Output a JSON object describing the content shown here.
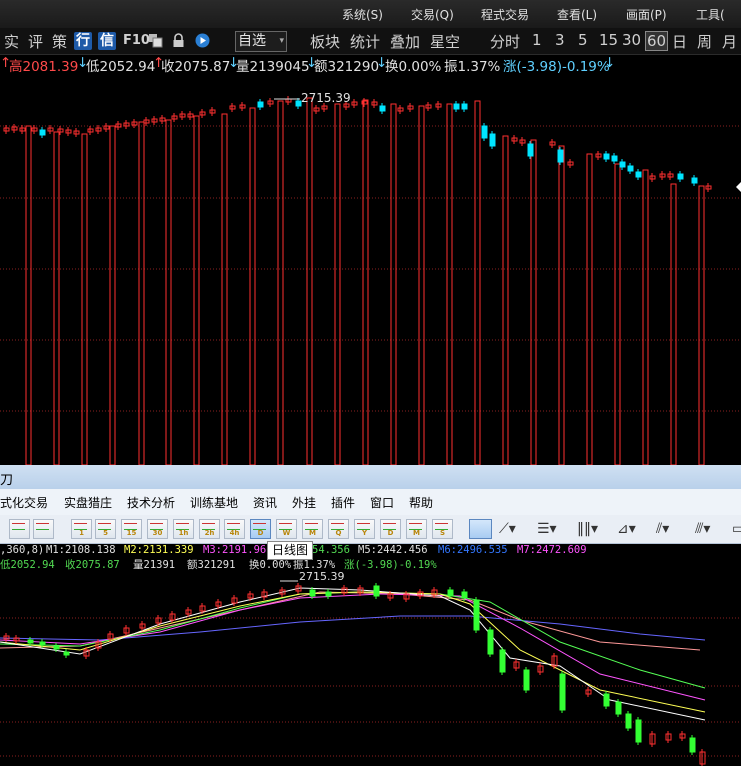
{
  "top": {
    "menu": [
      "系统(S)",
      "交易(Q)",
      "程式交易",
      "查看(L)",
      "画面(P)",
      "工具("
    ],
    "toolbar": {
      "left": [
        "实",
        "评",
        "策"
      ],
      "badges": [
        "行",
        "信"
      ],
      "f10": "F10",
      "dropdown": "自选",
      "groups": [
        "板块",
        "统计",
        "叠加",
        "星空"
      ],
      "periods": [
        "分时",
        "1",
        "3",
        "5",
        "15",
        "30",
        "60",
        "日",
        "周",
        "月"
      ],
      "selected_period": "60"
    },
    "stats": {
      "high": "高2081.39",
      "low": "低2052.94",
      "close": "收2075.87",
      "volume": "量2139045",
      "amount": "额321290",
      "turnover": "换0.00%",
      "amplitude": "振1.37%",
      "change": "涨(-3.98)-0.19%",
      "high_arrow": "↑",
      "low_arrow": "↓",
      "close_arrow": "↑",
      "vol_arrow": "↓",
      "amt_arrow": "↓",
      "chg_arrow": "↓"
    },
    "max_label": "2715.39"
  },
  "bottom": {
    "title": "刀",
    "menu": [
      "式化交易",
      "实盘猎庄",
      "技术分析",
      "训练基地",
      "资讯",
      "外挂",
      "插件",
      "窗口",
      "帮助"
    ],
    "tool_labels": [
      "1",
      "5",
      "15",
      "30",
      "1h",
      "2h",
      "4h",
      "D",
      "W",
      "M",
      "Q",
      "Y",
      "D",
      "M",
      "S"
    ],
    "tooltip": "日线图",
    "ma_line": {
      "params": ",360,8)",
      "m1": "M1:2108.138",
      "m2": "M2:2131.339",
      "m3": "M3:2191.96",
      "m4": "54.356",
      "m5": "M5:2442.456",
      "m6": "M6:2496.535",
      "m7": "M7:2472.609"
    },
    "stats": {
      "low": "低2052.94",
      "close": "收2075.87",
      "volume": "量21391",
      "amount": "额321291",
      "turnover": "换0.00%",
      "amplitude": "振1.37%",
      "change": "涨(-3.98)-0.19%"
    },
    "max_label": "2715.39"
  },
  "colors": {
    "candle_up": "#ff3030",
    "candle_down": "#00e5ff",
    "candle_down_bottom": "#33ff33",
    "grid": "#8a1f1f",
    "ma": [
      "#ffffff",
      "#ffff55",
      "#ff55ff",
      "#55ff55",
      "#6666ff",
      "#ff9999"
    ]
  },
  "chart_data": {
    "type": "candlestick",
    "max_price": 2715.39,
    "last_close": 2075.87,
    "last_low": 2052.94,
    "last_high": 2081.39
  }
}
